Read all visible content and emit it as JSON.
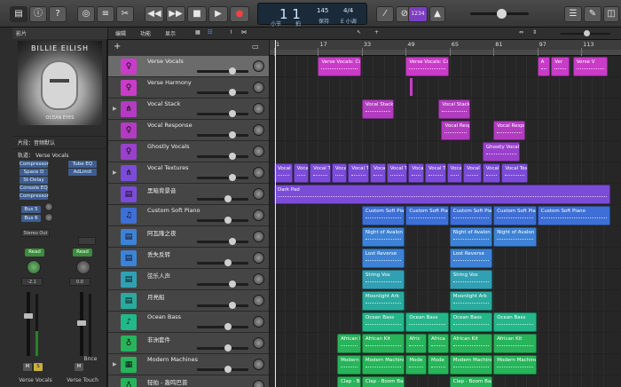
{
  "app": {
    "accent": "#3d82d6"
  },
  "toolbar": {
    "left_icons": [
      "library-icon",
      "info-icon",
      "help-icon",
      "smart-controls-icon",
      "mixer-icon",
      "scissors-icon"
    ],
    "transport_icons": [
      "rewind-icon",
      "fast-forward-icon",
      "stop-icon",
      "play-icon",
      "record-icon",
      "cycle-icon"
    ],
    "lcd": {
      "position": "1  1",
      "tempo": "145",
      "tempo_label": "保持",
      "time_sig": "4/4",
      "key": "E 小调",
      "bar_label": "小节",
      "beat_label": "拍"
    },
    "count_in": "1234",
    "right_icons": [
      "tuner-icon",
      "metronome-icon",
      "list-editor-icon",
      "notepad-icon",
      "loop-browser-icon",
      "browser-icon"
    ]
  },
  "inspector": {
    "header": "影片",
    "album_title": "BILLIE EILISH",
    "album_subtitle": "OCEAN EYES",
    "region_row": "片段：音频默认",
    "track_row": "轨道：",
    "track_name": "Verse Vocals",
    "plugins_left": [
      "Compressor",
      "Space D",
      "St-Delay",
      "Console EQ",
      "Compressor"
    ],
    "plugins_right": [
      "Tube EQ",
      "AdLimit"
    ],
    "sends": [
      "Bus 5",
      "Bus 6"
    ],
    "output": "Stereo Out",
    "automation": "Read",
    "left_value": "-2.1",
    "right_value": "0.0",
    "bounce": "Bnce",
    "left_name": "Verse Vocals",
    "right_name": "Verse Touch"
  },
  "tracks_toolbar": {
    "menus": [
      "编辑",
      "功能",
      "显示"
    ]
  },
  "ruler": {
    "bars": [
      "1",
      "17",
      "33",
      "49",
      "65",
      "81",
      "97",
      "113"
    ]
  },
  "tracks": [
    {
      "name": "Verse Vocals",
      "color": "#c83cc8",
      "icon": "vocal-icon",
      "vol": 0.72
    },
    {
      "name": "Verse Harmony",
      "color": "#c83cc8",
      "icon": "vocal-icon",
      "vol": 0.72
    },
    {
      "name": "Vocal Stack",
      "color": "#b23cc0",
      "icon": "stack-icon",
      "vol": 0.72
    },
    {
      "name": "Vocal Response",
      "color": "#b23cc0",
      "icon": "vocal-icon",
      "vol": 0.72
    },
    {
      "name": "Ghostly Vocals",
      "color": "#9a40cc",
      "icon": "vocal-icon",
      "vol": 0.72
    },
    {
      "name": "Vocal Textures",
      "color": "#7b4cd8",
      "icon": "stack-icon",
      "vol": 0.72
    },
    {
      "name": "黑暗背景音",
      "color": "#7b4cd8",
      "icon": "synth-icon",
      "vol": 0.62
    },
    {
      "name": "Custom Soft Piano",
      "color": "#3d6fd6",
      "icon": "piano-icon",
      "vol": 0.62
    },
    {
      "name": "阿瓦隆之夜",
      "color": "#3d82d6",
      "icon": "synth-icon",
      "vol": 0.72
    },
    {
      "name": "丢失反转",
      "color": "#3d82d6",
      "icon": "synth-icon",
      "vol": 0.62
    },
    {
      "name": "弦乐人声",
      "color": "#32a0b4",
      "icon": "synth-icon",
      "vol": 0.72
    },
    {
      "name": "月亮船",
      "color": "#2aaa9e",
      "icon": "synth-icon",
      "vol": 0.72
    },
    {
      "name": "Ocean Bass",
      "color": "#22b88a",
      "icon": "bass-icon",
      "vol": 0.62
    },
    {
      "name": "非洲套件",
      "color": "#28b45a",
      "icon": "drum-icon",
      "vol": 0.62
    },
    {
      "name": "Modern Machines",
      "color": "#28b45a",
      "icon": "drum-machine-icon",
      "vol": 0.62
    },
    {
      "name": "轻拍 - 轰鸣巴普",
      "color": "#28b45a",
      "icon": "drum-icon",
      "vol": 0.62
    }
  ],
  "regions": [
    {
      "lane": 0,
      "start": 17,
      "end": 33,
      "label": "Verse Vocals: Comp B"
    },
    {
      "lane": 0,
      "start": 49,
      "end": 65,
      "label": "Verse Vocals: Comp"
    },
    {
      "lane": 0,
      "start": 97,
      "end": 102,
      "label": "A"
    },
    {
      "lane": 0,
      "start": 102,
      "end": 109,
      "label": "Ver"
    },
    {
      "lane": 0,
      "start": 110,
      "end": 123,
      "label": "Verse V"
    },
    {
      "lane": 2,
      "start": 33,
      "end": 45,
      "label": "Vocal Stack"
    },
    {
      "lane": 2,
      "start": 61,
      "end": 73,
      "label": "Vocal Stack"
    },
    {
      "lane": 3,
      "start": 62,
      "end": 73,
      "label": "Vocal Respon"
    },
    {
      "lane": 3,
      "start": 81,
      "end": 93,
      "label": "Vocal Respo"
    },
    {
      "lane": 4,
      "start": 77,
      "end": 91,
      "label": "Ghostly Vocals"
    },
    {
      "lane": 5,
      "start": 1,
      "end": 8,
      "label": "Vocal Te"
    },
    {
      "lane": 5,
      "start": 8,
      "end": 14,
      "label": "Vocal T"
    },
    {
      "lane": 5,
      "start": 14,
      "end": 22,
      "label": "Vocal Text"
    },
    {
      "lane": 5,
      "start": 22,
      "end": 28,
      "label": "Vocal T"
    },
    {
      "lane": 5,
      "start": 28,
      "end": 36,
      "label": "Vocal Text"
    },
    {
      "lane": 5,
      "start": 36,
      "end": 42,
      "label": "Vocal T"
    },
    {
      "lane": 5,
      "start": 42,
      "end": 50,
      "label": "Vocal Text"
    },
    {
      "lane": 5,
      "start": 50,
      "end": 56,
      "label": "Vocal T"
    },
    {
      "lane": 5,
      "start": 56,
      "end": 64,
      "label": "Vocal Text"
    },
    {
      "lane": 5,
      "start": 64,
      "end": 70,
      "label": "Vocal T"
    },
    {
      "lane": 5,
      "start": 70,
      "end": 77,
      "label": "Vocal Text"
    },
    {
      "lane": 5,
      "start": 77,
      "end": 84,
      "label": "Vocal Text"
    },
    {
      "lane": 5,
      "start": 84,
      "end": 94,
      "label": "Vocal Text"
    },
    {
      "lane": 6,
      "start": 1,
      "end": 124,
      "label": "Dark Pad"
    },
    {
      "lane": 7,
      "start": 33,
      "end": 49,
      "label": "Custom Soft Piano"
    },
    {
      "lane": 7,
      "start": 49,
      "end": 65,
      "label": "Custom Soft Piano"
    },
    {
      "lane": 7,
      "start": 65,
      "end": 81,
      "label": "Custom Soft Piano"
    },
    {
      "lane": 7,
      "start": 81,
      "end": 97,
      "label": "Custom Soft Piano"
    },
    {
      "lane": 7,
      "start": 97,
      "end": 124,
      "label": "Custom Soft Piano"
    },
    {
      "lane": 8,
      "start": 33,
      "end": 49,
      "label": "Night of Avalon"
    },
    {
      "lane": 8,
      "start": 65,
      "end": 81,
      "label": "Night of Avalon"
    },
    {
      "lane": 8,
      "start": 81,
      "end": 97,
      "label": "Night of Avalon"
    },
    {
      "lane": 9,
      "start": 33,
      "end": 49,
      "label": "Lost Reverse"
    },
    {
      "lane": 9,
      "start": 65,
      "end": 81,
      "label": "Lost Reverse"
    },
    {
      "lane": 10,
      "start": 33,
      "end": 49,
      "label": "String Vox"
    },
    {
      "lane": 10,
      "start": 65,
      "end": 81,
      "label": "String Vox"
    },
    {
      "lane": 11,
      "start": 33,
      "end": 49,
      "label": "Moonlight Ark"
    },
    {
      "lane": 11,
      "start": 65,
      "end": 81,
      "label": "Moonlight Ark"
    },
    {
      "lane": 12,
      "start": 33,
      "end": 49,
      "label": "Ocean Bass"
    },
    {
      "lane": 12,
      "start": 49,
      "end": 65,
      "label": "Ocean Bass"
    },
    {
      "lane": 12,
      "start": 65,
      "end": 81,
      "label": "Ocean Bass"
    },
    {
      "lane": 12,
      "start": 81,
      "end": 97,
      "label": "Ocean Bass"
    },
    {
      "lane": 13,
      "start": 24,
      "end": 33,
      "label": "African Kit"
    },
    {
      "lane": 13,
      "start": 33,
      "end": 49,
      "label": "African Kit"
    },
    {
      "lane": 13,
      "start": 49,
      "end": 57,
      "label": "Afric"
    },
    {
      "lane": 13,
      "start": 57,
      "end": 65,
      "label": "Africa"
    },
    {
      "lane": 13,
      "start": 65,
      "end": 81,
      "label": "African Kit"
    },
    {
      "lane": 13,
      "start": 81,
      "end": 97,
      "label": "African Kit"
    },
    {
      "lane": 14,
      "start": 24,
      "end": 33,
      "label": "Modern M"
    },
    {
      "lane": 14,
      "start": 33,
      "end": 49,
      "label": "Modern Machines"
    },
    {
      "lane": 14,
      "start": 49,
      "end": 57,
      "label": "Mode"
    },
    {
      "lane": 14,
      "start": 57,
      "end": 65,
      "label": "Mode"
    },
    {
      "lane": 14,
      "start": 65,
      "end": 81,
      "label": "Modern Machines"
    },
    {
      "lane": 14,
      "start": 81,
      "end": 97,
      "label": "Modern Machines"
    },
    {
      "lane": 15,
      "start": 24,
      "end": 33,
      "label": "Clap - Boo"
    },
    {
      "lane": 15,
      "start": 33,
      "end": 49,
      "label": "Clap - Boom Bap"
    },
    {
      "lane": 15,
      "start": 65,
      "end": 81,
      "label": "Clap - Boom Bap"
    }
  ]
}
